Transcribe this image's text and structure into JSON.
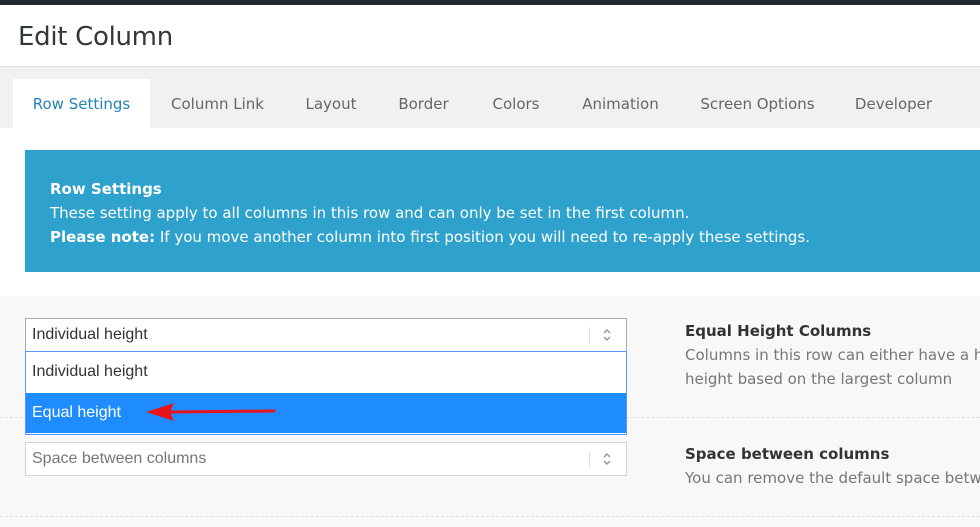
{
  "header": {
    "title": "Edit Column"
  },
  "tabs": [
    {
      "label": "Row Settings",
      "active": true
    },
    {
      "label": "Column Link",
      "active": false
    },
    {
      "label": "Layout",
      "active": false
    },
    {
      "label": "Border",
      "active": false
    },
    {
      "label": "Colors",
      "active": false
    },
    {
      "label": "Animation",
      "active": false
    },
    {
      "label": "Screen Options",
      "active": false
    },
    {
      "label": "Developer",
      "active": false
    }
  ],
  "notice": {
    "title": "Row Settings",
    "body": "These setting apply to all columns in this row and can only be set in the first column.",
    "note_label": "Please note:",
    "note_text": " If you move another column into first position you will need to re-apply these settings."
  },
  "equal_height": {
    "select_value": "Individual height",
    "options": [
      "Individual height",
      "Equal height"
    ],
    "highlighted_option": "Equal height",
    "title": "Equal Height Columns",
    "desc_line1": "Columns in this row can either have a hei",
    "desc_line2": "height based on the largest column"
  },
  "space_between": {
    "select_value": "Space between columns",
    "title": "Space between columns",
    "desc_line1": "You can remove the default space betwee"
  },
  "colors": {
    "accent": "#2582b7",
    "notice_bg": "#2ea2cc",
    "highlight": "#1e8cff",
    "annotation_arrow": "#e8141b"
  },
  "icons": {
    "select_arrow": "up-down-chevron-icon",
    "annotation": "red-arrow-icon"
  }
}
